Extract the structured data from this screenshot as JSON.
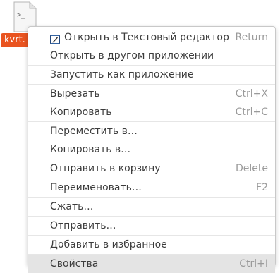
{
  "desktop": {
    "file_name": "kvrt.",
    "file_icon_glyph": ">_"
  },
  "context_menu": {
    "items": [
      {
        "label": "Открыть в Текстовый редактор",
        "shortcut": "Return",
        "icon": "text-editor-icon"
      },
      {
        "label": "Открыть в другом приложении",
        "shortcut": ""
      },
      {
        "label": "Запустить как приложение",
        "shortcut": ""
      },
      {
        "label": "Вырезать",
        "shortcut": "Ctrl+X"
      },
      {
        "label": "Копировать",
        "shortcut": "Ctrl+C"
      },
      {
        "label": "Переместить в…",
        "shortcut": ""
      },
      {
        "label": "Копировать в…",
        "shortcut": ""
      },
      {
        "label": "Отправить в корзину",
        "shortcut": "Delete"
      },
      {
        "label": "Переименовать…",
        "shortcut": "F2"
      },
      {
        "label": "Сжать…",
        "shortcut": ""
      },
      {
        "label": "Отправить…",
        "shortcut": ""
      },
      {
        "label": "Добавить в избранное",
        "shortcut": ""
      },
      {
        "label": "Свойства",
        "shortcut": "Ctrl+I"
      }
    ],
    "highlighted_index": 12
  },
  "colors": {
    "selection_label": "#e95420",
    "highlight_row": "#e4e4e4"
  }
}
